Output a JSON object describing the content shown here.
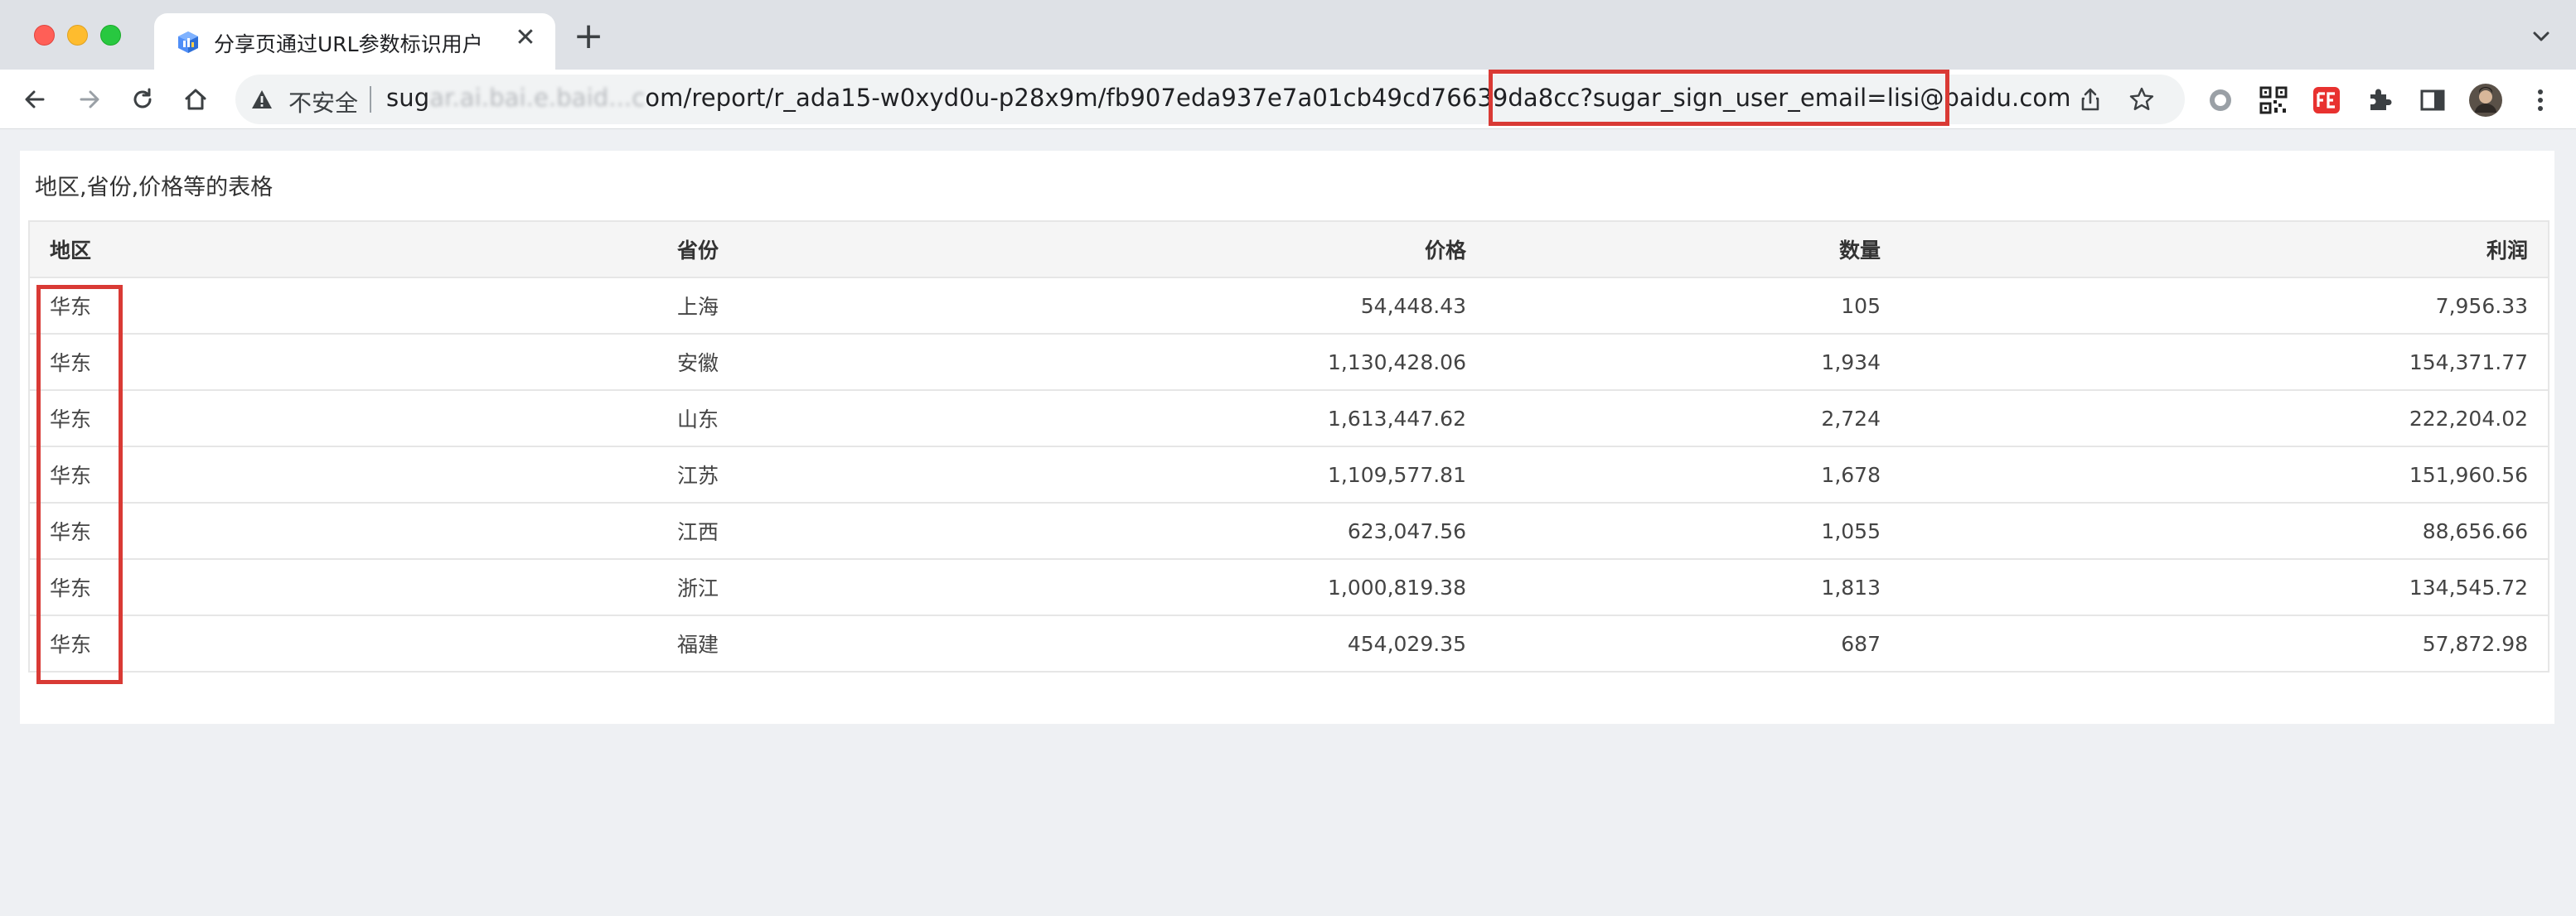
{
  "window": {
    "traffic_lights": [
      "close",
      "minimize",
      "zoom"
    ]
  },
  "tab": {
    "title": "分享页通过URL参数标识用户",
    "close_glyph": "✕",
    "new_tab_glyph": "+"
  },
  "omnibox": {
    "security_label": "不安全",
    "url_prefix": "sug",
    "url_blurred": "ar.ai.bai.e.baid...c",
    "url_host_visible": "om/report/r_ada15-w0xyd0u-p28x9m/fb907eda937e7a01cb49cd76639da8cc",
    "url_query": "?sugar_sign_user_email=lisi@baidu.com"
  },
  "colors": {
    "highlight": "#d93a35",
    "tab_strip": "#dee1e6",
    "page_bg": "#eef0f3"
  },
  "report": {
    "title": "地区,省份,价格等的表格",
    "columns": [
      "地区",
      "省份",
      "价格",
      "数量",
      "利润"
    ],
    "rows": [
      [
        "华东",
        "上海",
        "54,448.43",
        "105",
        "7,956.33"
      ],
      [
        "华东",
        "安徽",
        "1,130,428.06",
        "1,934",
        "154,371.77"
      ],
      [
        "华东",
        "山东",
        "1,613,447.62",
        "2,724",
        "222,204.02"
      ],
      [
        "华东",
        "江苏",
        "1,109,577.81",
        "1,678",
        "151,960.56"
      ],
      [
        "华东",
        "江西",
        "623,047.56",
        "1,055",
        "88,656.66"
      ],
      [
        "华东",
        "浙江",
        "1,000,819.38",
        "1,813",
        "134,545.72"
      ],
      [
        "华东",
        "福建",
        "454,029.35",
        "687",
        "57,872.98"
      ]
    ]
  }
}
